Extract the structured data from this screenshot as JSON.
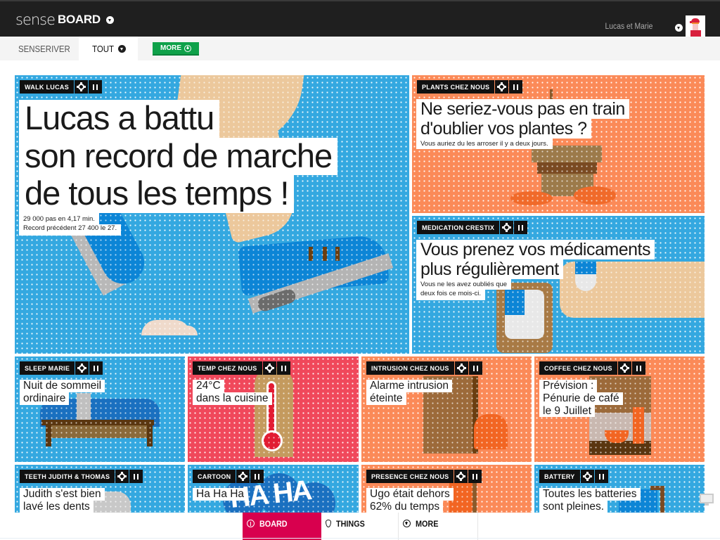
{
  "header": {
    "logo_light": "sense",
    "logo_bold": "BOARD",
    "user_name": "Lucas et Marie"
  },
  "tabs": {
    "senseriver": "SENSERIVER",
    "tout": "TOUT",
    "more": "MORE"
  },
  "colors": {
    "blue": "#34a8e0",
    "orange": "#fb8a58",
    "red": "#f0485b",
    "accent_green": "#0fa14a",
    "accent_board": "#d8004e"
  },
  "tiles": [
    {
      "label": "WALK LUCAS",
      "headline": [
        "Lucas a battu",
        "son record de marche",
        "de tous les temps !"
      ],
      "sub": [
        "29 000 pas en 4,17 min.",
        "Record précédent 27 400 le 27."
      ],
      "color": "blue"
    },
    {
      "label": "PLANTS CHEZ NOUS",
      "headline": [
        "Ne seriez-vous pas en train",
        "d'oublier vos plantes ?"
      ],
      "sub": [
        "Vous auriez du les arroser il y a deux jours."
      ],
      "color": "orange"
    },
    {
      "label": "MEDICATION CRESTIX",
      "headline": [
        "Vous prenez vos médicaments",
        "plus régulièrement"
      ],
      "sub": [
        "Vous ne les avez oubliés que",
        "deux fois ce mois-ci."
      ],
      "color": "blue"
    },
    {
      "label": "SLEEP MARIE",
      "headline": [
        "Nuit de sommeil",
        "ordinaire"
      ],
      "color": "blue"
    },
    {
      "label": "TEMP CHEZ NOUS",
      "headline": [
        "24°C",
        "dans la cuisine"
      ],
      "color": "red"
    },
    {
      "label": "INTRUSION CHEZ NOUS",
      "headline": [
        "Alarme intrusion",
        "éteinte"
      ],
      "color": "orange"
    },
    {
      "label": "COFFEE CHEZ NOUS",
      "headline": [
        "Prévision :",
        "Pénurie de café",
        "le 9 Juillet"
      ],
      "color": "orange"
    },
    {
      "label": "TEETH JUDITH & THOMAS",
      "headline": [
        "Judith s'est bien",
        "lavé les dents"
      ],
      "color": "blue"
    },
    {
      "label": "CARTOON",
      "headline": [
        "Ha Ha Ha"
      ],
      "cartoon_text": "HA HA",
      "color": "blue"
    },
    {
      "label": "PRESENCE CHEZ NOUS",
      "headline": [
        "Ugo était dehors",
        "62% du temps"
      ],
      "color": "orange"
    },
    {
      "label": "BATTERY",
      "headline": [
        "Toutes les batteries",
        "sont pleines."
      ],
      "color": "blue"
    }
  ],
  "bottom_nav": {
    "board": "BOARD",
    "things": "THINGS",
    "more": "MORE"
  }
}
